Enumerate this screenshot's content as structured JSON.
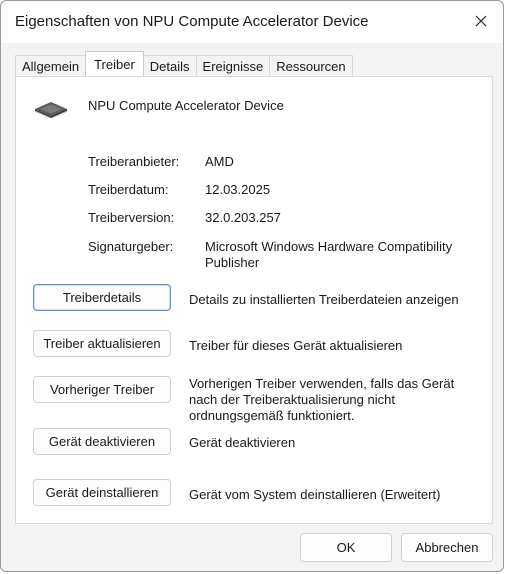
{
  "window": {
    "title": "Eigenschaften von NPU Compute Accelerator Device"
  },
  "tabs": [
    {
      "label": "Allgemein"
    },
    {
      "label": "Treiber"
    },
    {
      "label": "Details"
    },
    {
      "label": "Ereignisse"
    },
    {
      "label": "Ressourcen"
    }
  ],
  "active_tab": "Treiber",
  "device": {
    "name": "NPU Compute Accelerator Device",
    "icon": "chip-icon"
  },
  "info": [
    {
      "label": "Treiberanbieter:",
      "value": "AMD"
    },
    {
      "label": "Treiberdatum:",
      "value": "12.03.2025"
    },
    {
      "label": "Treiberversion:",
      "value": "32.0.203.257"
    },
    {
      "label": "Signaturgeber:",
      "value": "Microsoft Windows Hardware Compatibility Publisher"
    }
  ],
  "actions": [
    {
      "button": "Treiberdetails",
      "description": "Details zu installierten Treiberdateien anzeigen"
    },
    {
      "button": "Treiber aktualisieren",
      "description": "Treiber für dieses Gerät aktualisieren"
    },
    {
      "button": "Vorheriger Treiber",
      "description": "Vorherigen Treiber verwenden, falls das Gerät nach der Treiberaktualisierung nicht ordnungsgemäß funktioniert."
    },
    {
      "button": "Gerät deaktivieren",
      "description": "Gerät deaktivieren"
    },
    {
      "button": "Gerät deinstallieren",
      "description": "Gerät vom System deinstallieren (Erweitert)"
    }
  ],
  "footer": {
    "ok_label": "OK",
    "cancel_label": "Abbrechen"
  },
  "colors": {
    "accent": "#5a8fd6",
    "window_bg": "#f3f3f3",
    "panel_bg": "#ffffff"
  }
}
